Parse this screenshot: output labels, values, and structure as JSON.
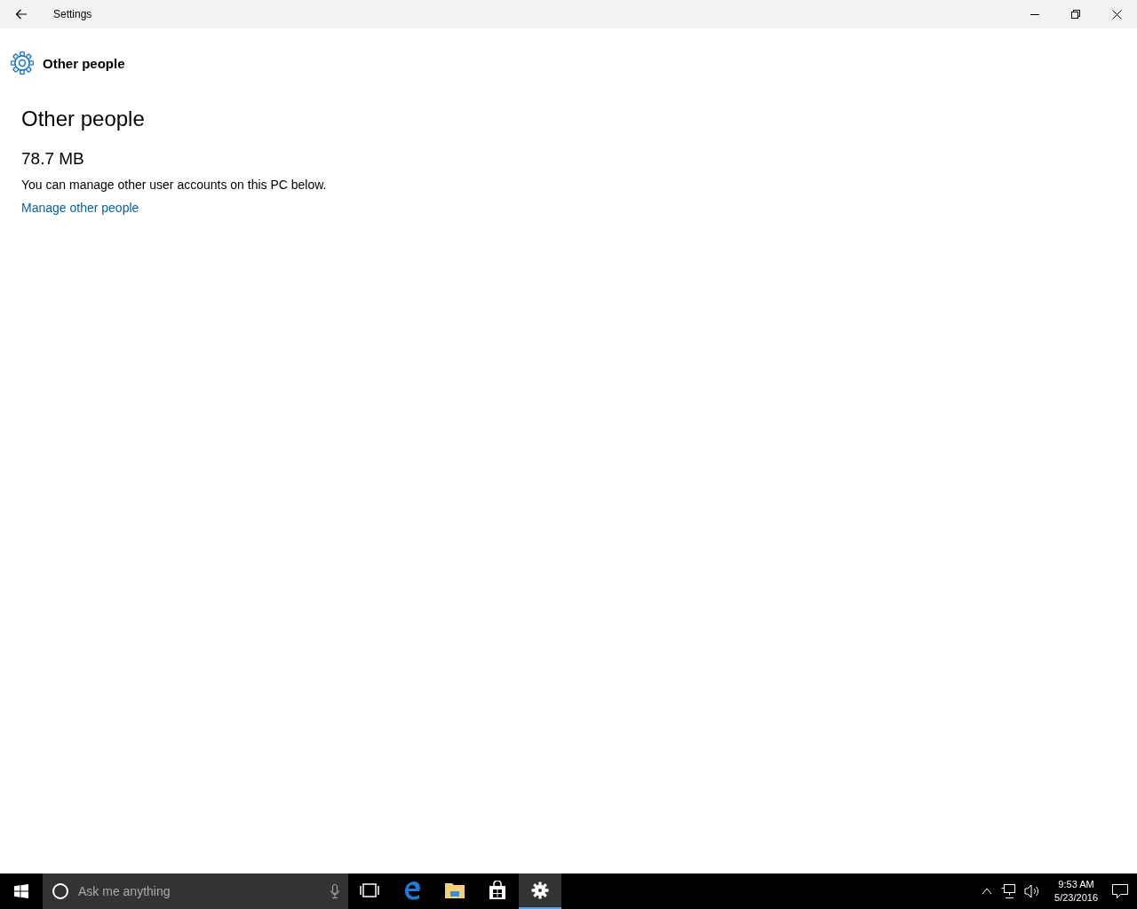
{
  "window": {
    "title": "Settings"
  },
  "header": {
    "title": "Other people"
  },
  "page": {
    "heading": "Other people",
    "size": "78.7 MB",
    "description": "You can manage other user accounts on this PC below.",
    "link": "Manage other people"
  },
  "taskbar": {
    "search": {
      "placeholder": "Ask me anything"
    },
    "apps": [
      {
        "kind": "taskview",
        "selected": false
      },
      {
        "kind": "edge",
        "selected": false
      },
      {
        "kind": "explorer",
        "selected": false
      },
      {
        "kind": "store",
        "selected": false
      },
      {
        "kind": "settings",
        "selected": true
      }
    ],
    "clock": {
      "time": "9:53 AM",
      "date": "5/23/2016"
    }
  }
}
